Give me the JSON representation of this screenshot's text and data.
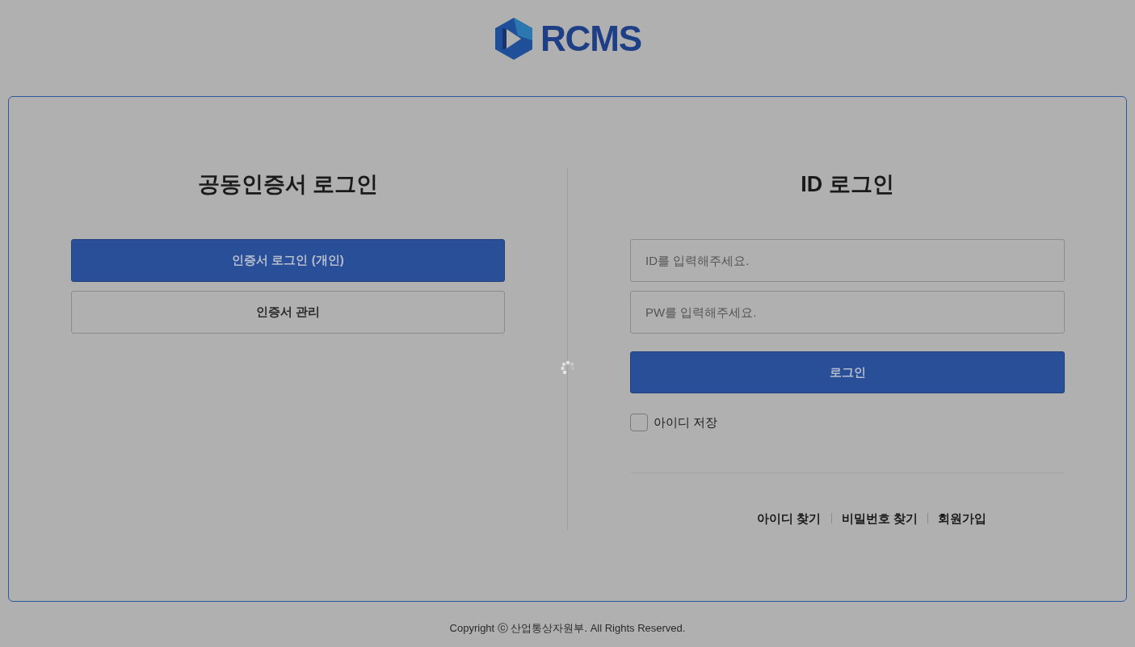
{
  "logo": {
    "text": "RCMS"
  },
  "certificate_login": {
    "title": "공동인증서 로그인",
    "buttons": [
      {
        "label": "인증서 로그인 (개인)",
        "kind": "primary"
      },
      {
        "label": "인증서 관리",
        "kind": "secondary"
      }
    ]
  },
  "id_login": {
    "title": "ID 로그인",
    "fields": [
      {
        "placeholder": "ID를 입력해주세요."
      },
      {
        "placeholder": "PW를 입력해주세요."
      }
    ],
    "submit": "로그인",
    "remember": {
      "label": "아이디 저장",
      "checked": false
    },
    "links": [
      "아이디 찾기",
      "비밀번호 찾기",
      "회원가입"
    ]
  },
  "loading": true,
  "footer": "Copyright ⓒ 산업통상자원부. All Rights Reserved."
}
